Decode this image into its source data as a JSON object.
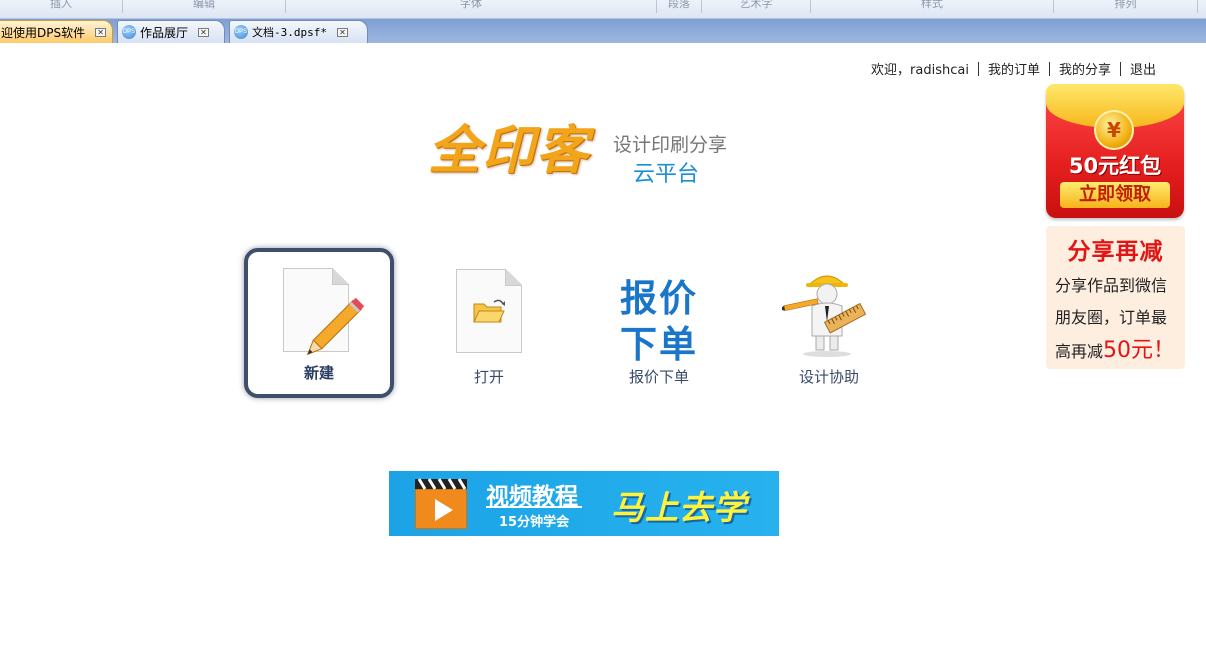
{
  "ribbon": {
    "groups": [
      "插入",
      "编辑",
      "字体",
      "段落",
      "艺术字",
      "样式",
      "排列"
    ]
  },
  "tabs": [
    {
      "label": "迎使用DPS软件",
      "active": true
    },
    {
      "label": "作品展厅",
      "active": false
    },
    {
      "label": "文档-3.dpsf*",
      "active": false
    }
  ],
  "tab_icon_text": "DPS",
  "tab_close_glyph": "⊠",
  "userbar": {
    "welcome": "欢迎，radishcai",
    "orders": "我的订单",
    "shares": "我的分享",
    "logout": "退出"
  },
  "logo": {
    "brand": "全印客",
    "tagline1": "设计印刷分享",
    "tagline2": "云平台"
  },
  "actions": {
    "new": "新建",
    "open": "打开",
    "quote_icon_line1": "报价",
    "quote_icon_line2": "下单",
    "quote": "报价下单",
    "design": "设计协助"
  },
  "video_banner": {
    "title": "视频教程",
    "subtitle": "15分钟学会",
    "cta": "马上去学"
  },
  "red_packet": {
    "coin": "¥",
    "amount": "50元红包",
    "button": "立即领取"
  },
  "share_promo": {
    "heading": "分享再减",
    "line1": "分享作品到微信",
    "line2": "朋友圈，订单最",
    "line3_prefix": "高再减",
    "line3_highlight": "50元！"
  },
  "colors": {
    "tab_bar": "#8faad9",
    "active_tab": "#ffc96a",
    "accent_blue": "#1976c8",
    "banner_blue": "#1ba3e6",
    "promo_red": "#e21414",
    "selection_border": "#3f4e6b"
  }
}
